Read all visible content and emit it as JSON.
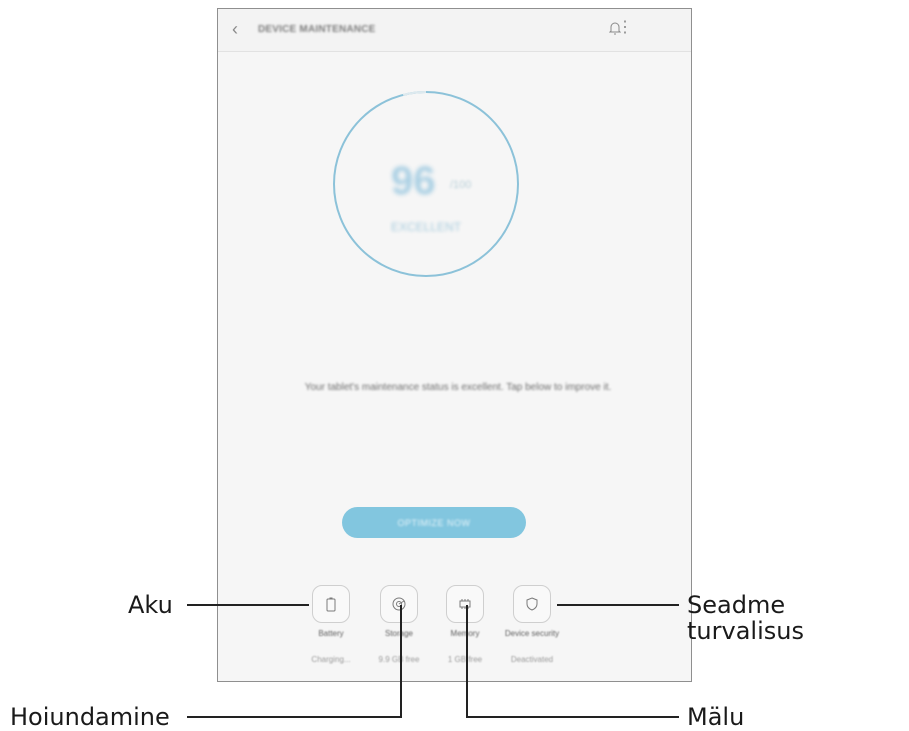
{
  "screen": {
    "title": "DEVICE MAINTENANCE",
    "score": "96",
    "score_unit": "/100",
    "rating": "EXCELLENT",
    "progress_fraction": 0.96,
    "message": "Your tablet's maintenance status is excellent. Tap below to improve it.",
    "optimize_button": "OPTIMIZE NOW",
    "colors": {
      "accent": "#82c6df",
      "ring": "#8cc2d9"
    },
    "tiles": [
      {
        "label": "Battery",
        "status": "Charging...",
        "icon": "battery-icon"
      },
      {
        "label": "Storage",
        "status": "9.9 GB free",
        "icon": "storage-icon"
      },
      {
        "label": "Memory",
        "status": "1 GB free",
        "icon": "memory-icon"
      },
      {
        "label": "Device security",
        "status": "Deactivated",
        "icon": "shield-icon"
      }
    ]
  },
  "callouts": {
    "battery": "Aku",
    "storage": "Hoiundamine",
    "memory": "Mälu",
    "security": "Seadme turvalisus"
  }
}
